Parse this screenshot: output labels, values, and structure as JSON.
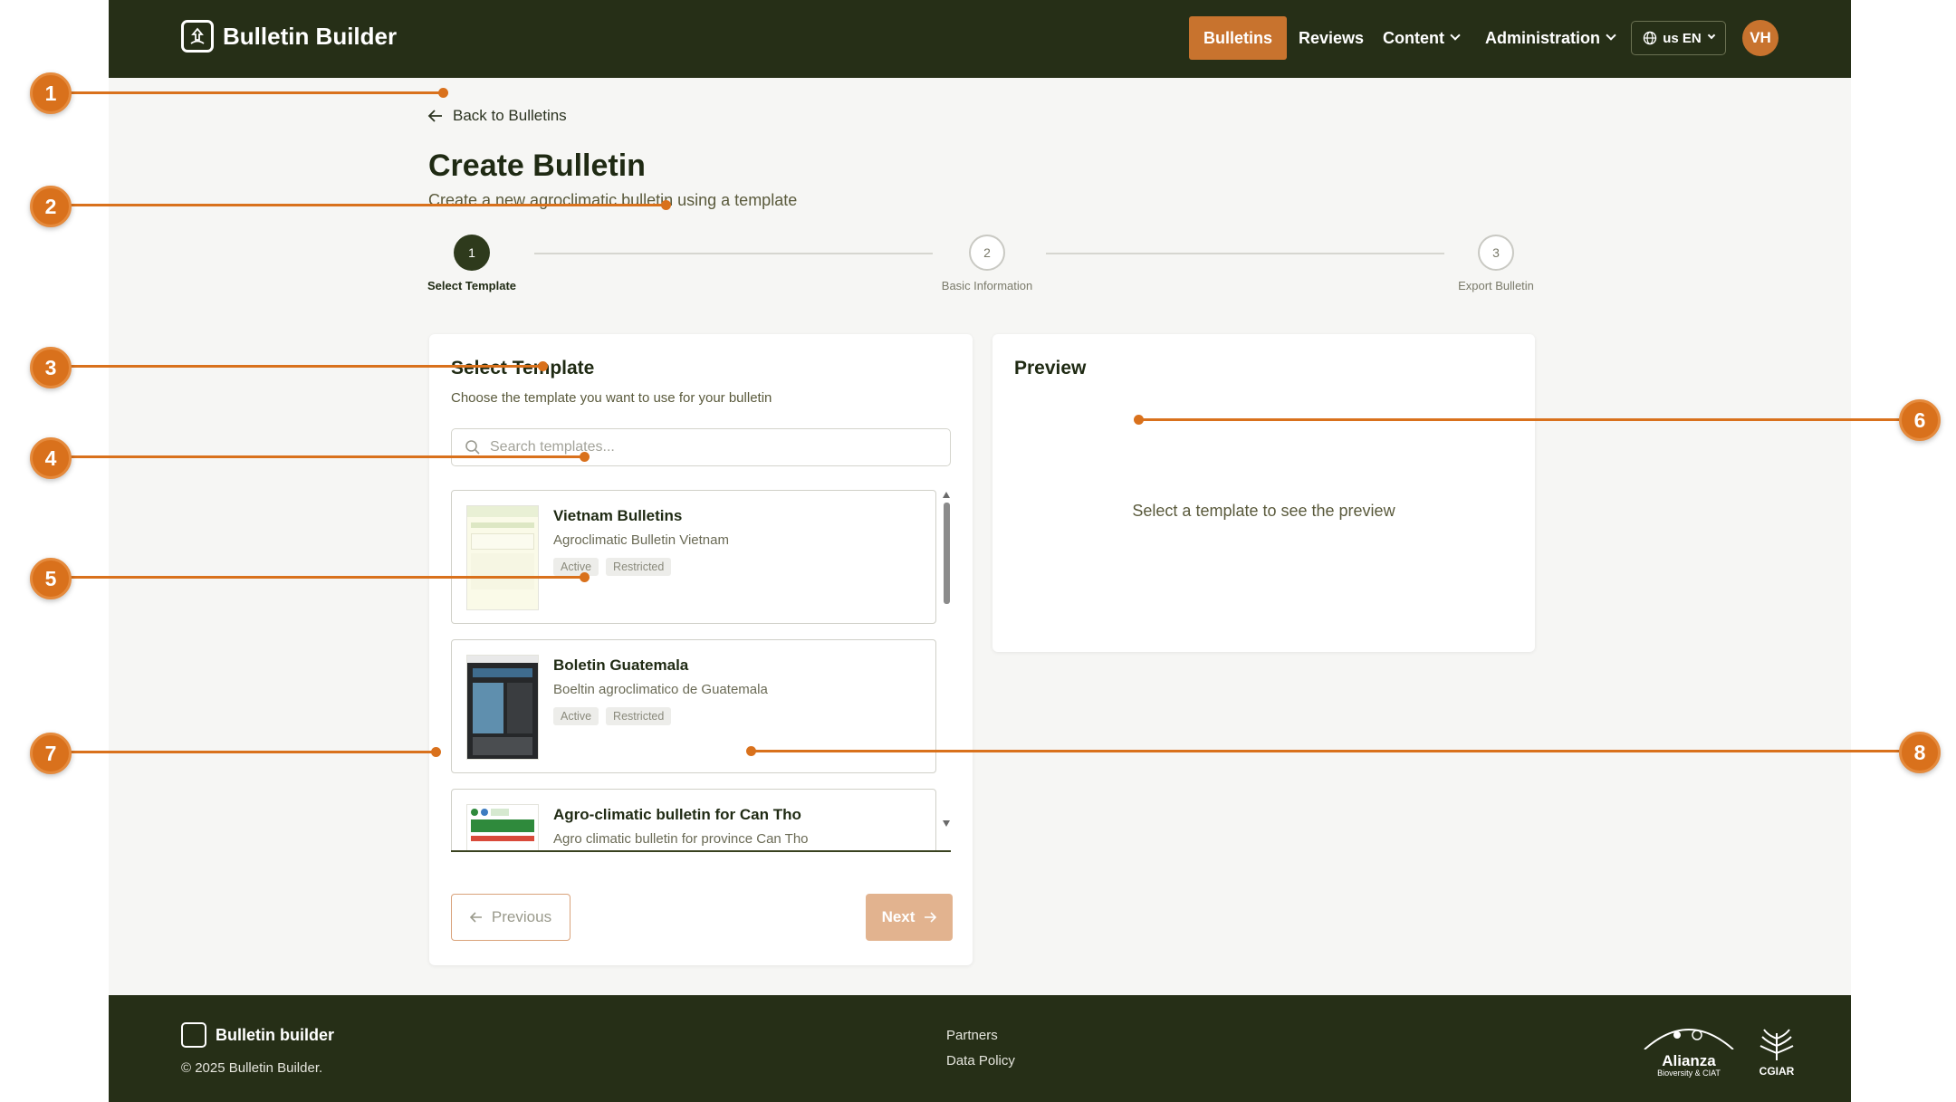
{
  "app": {
    "title": "Bulletin Builder"
  },
  "nav": {
    "items": [
      {
        "label": "Bulletins",
        "active": true
      },
      {
        "label": "Reviews"
      },
      {
        "label": "Content",
        "has_dropdown": true
      },
      {
        "label": "Administration",
        "has_dropdown": true
      }
    ],
    "language": "us EN",
    "avatar_initials": "VH"
  },
  "page": {
    "back_label": "Back to Bulletins",
    "title": "Create Bulletin",
    "subtitle": "Create a new agroclimatic bulletin using a template"
  },
  "stepper": {
    "steps": [
      {
        "number": "1",
        "label": "Select Template",
        "state": "current"
      },
      {
        "number": "2",
        "label": "Basic Information",
        "state": "upcoming"
      },
      {
        "number": "3",
        "label": "Export Bulletin",
        "state": "upcoming"
      }
    ]
  },
  "select_template": {
    "title": "Select Template",
    "subtitle": "Choose the template you want to use for your bulletin",
    "search_placeholder": "Search templates...",
    "templates": [
      {
        "name": "Vietnam Bulletins",
        "description": "Agroclimatic Bulletin Vietnam",
        "badges": [
          "Active",
          "Restricted"
        ]
      },
      {
        "name": "Boletin Guatemala",
        "description": "Boeltin agroclimatico de Guatemala",
        "badges": [
          "Active",
          "Restricted"
        ]
      },
      {
        "name": "Agro-climatic bulletin for Can Tho",
        "description": "Agro climatic bulletin for province Can Tho"
      }
    ],
    "previous_label": "Previous",
    "next_label": "Next"
  },
  "preview": {
    "title": "Preview",
    "empty_message": "Select a template to see the preview"
  },
  "footer": {
    "brand": "Bulletin builder",
    "copyright": "© 2025 Bulletin Builder.",
    "links": [
      "Partners",
      "Data Policy"
    ],
    "partner_logos": [
      {
        "name": "Alianza",
        "subtitle": "Bioversity & CIAT"
      },
      {
        "name": "CGIAR"
      }
    ]
  },
  "annotations": [
    "1",
    "2",
    "3",
    "4",
    "5",
    "6",
    "7",
    "8"
  ],
  "colors": {
    "header_bg": "#262f17",
    "accent": "#c8732e",
    "annotation": "#d9711c",
    "page_bg": "#f6f6f4"
  }
}
